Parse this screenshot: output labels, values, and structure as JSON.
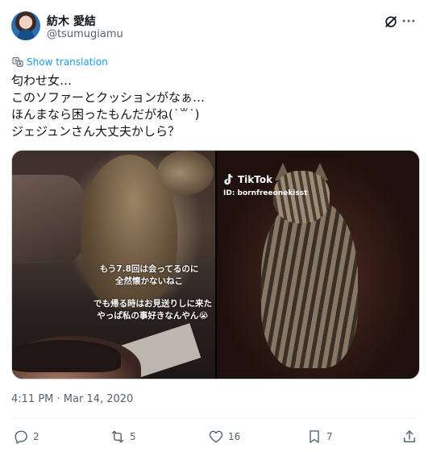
{
  "author": {
    "display_name": "紡木 愛結",
    "handle": "@tsumugiamu"
  },
  "header_icons": [
    "grok-icon",
    "more-icon"
  ],
  "translate": {
    "label": "Show translation",
    "icon": "translate-icon"
  },
  "tweet": {
    "lines": [
      "匂わせ女…",
      "このソファーとクッションがなぁ…",
      "ほんまなら困ったもんだがね(˙꒳˙)",
      "ジェジュンさん大丈夫かしら？"
    ]
  },
  "media": {
    "left": {
      "caption_line1": "もう7.8回は会ってるのに",
      "caption_line2": "全然懐かないねこ",
      "caption_line3": "でも帰る時はお見送りしに来た",
      "caption_line4": "やっぱ私の事好きなんやん😭"
    },
    "right": {
      "tiktok_label": "TikTok",
      "tiktok_id": "ID: bornfreeonekisst"
    }
  },
  "timestamp": "4:11 PM · Mar 14, 2020",
  "actions": {
    "reply_count": "2",
    "retweet_count": "5",
    "like_count": "16",
    "bookmark_count": "7"
  },
  "colors": {
    "text": "#0f1419",
    "secondary": "#536471",
    "accent": "#1d9bf0",
    "border": "#cfd9de"
  }
}
